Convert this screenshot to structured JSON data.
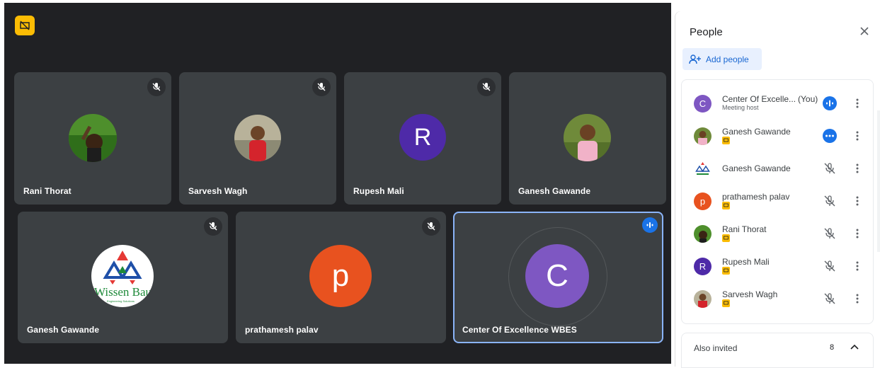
{
  "tiles": [
    {
      "name": "Rani Thorat"
    },
    {
      "name": "Sarvesh Wagh"
    },
    {
      "name": "Rupesh Mali",
      "initial": "R",
      "color": "#4e2aa8"
    },
    {
      "name": "Ganesh Gawande"
    },
    {
      "name": "Ganesh Gawande",
      "logo_text": "Wissen Baum",
      "logo_sub": "Engineering Solutions"
    },
    {
      "name": "prathamesh palav",
      "initial": "p",
      "color": "#e8521f"
    },
    {
      "name": "Center Of Excellence WBES",
      "initial": "C",
      "color": "#7e57c2"
    }
  ],
  "panel": {
    "title": "People",
    "add_people": "Add people",
    "participants": [
      {
        "name": "Center Of Excelle...",
        "you": "(You)",
        "sub": "Meeting host",
        "initial": "C",
        "color": "#7e57c2",
        "status": "speaking"
      },
      {
        "name": "Ganesh Gawande",
        "status": "more-options"
      },
      {
        "name": "Ganesh Gawande",
        "status": "muted"
      },
      {
        "name": "prathamesh palav",
        "initial": "p",
        "color": "#e8521f",
        "status": "muted"
      },
      {
        "name": "Rani Thorat",
        "status": "muted"
      },
      {
        "name": "Rupesh Mali",
        "initial": "R",
        "color": "#4e2aa8",
        "status": "muted"
      },
      {
        "name": "Sarvesh Wagh",
        "status": "muted"
      }
    ],
    "also_invited": "Also invited",
    "invited_count": "8"
  },
  "colors": {
    "meet_bg": "#202124",
    "tile_bg": "#3c4043",
    "accent": "#1a73e8",
    "active_border": "#8ab4f8"
  }
}
